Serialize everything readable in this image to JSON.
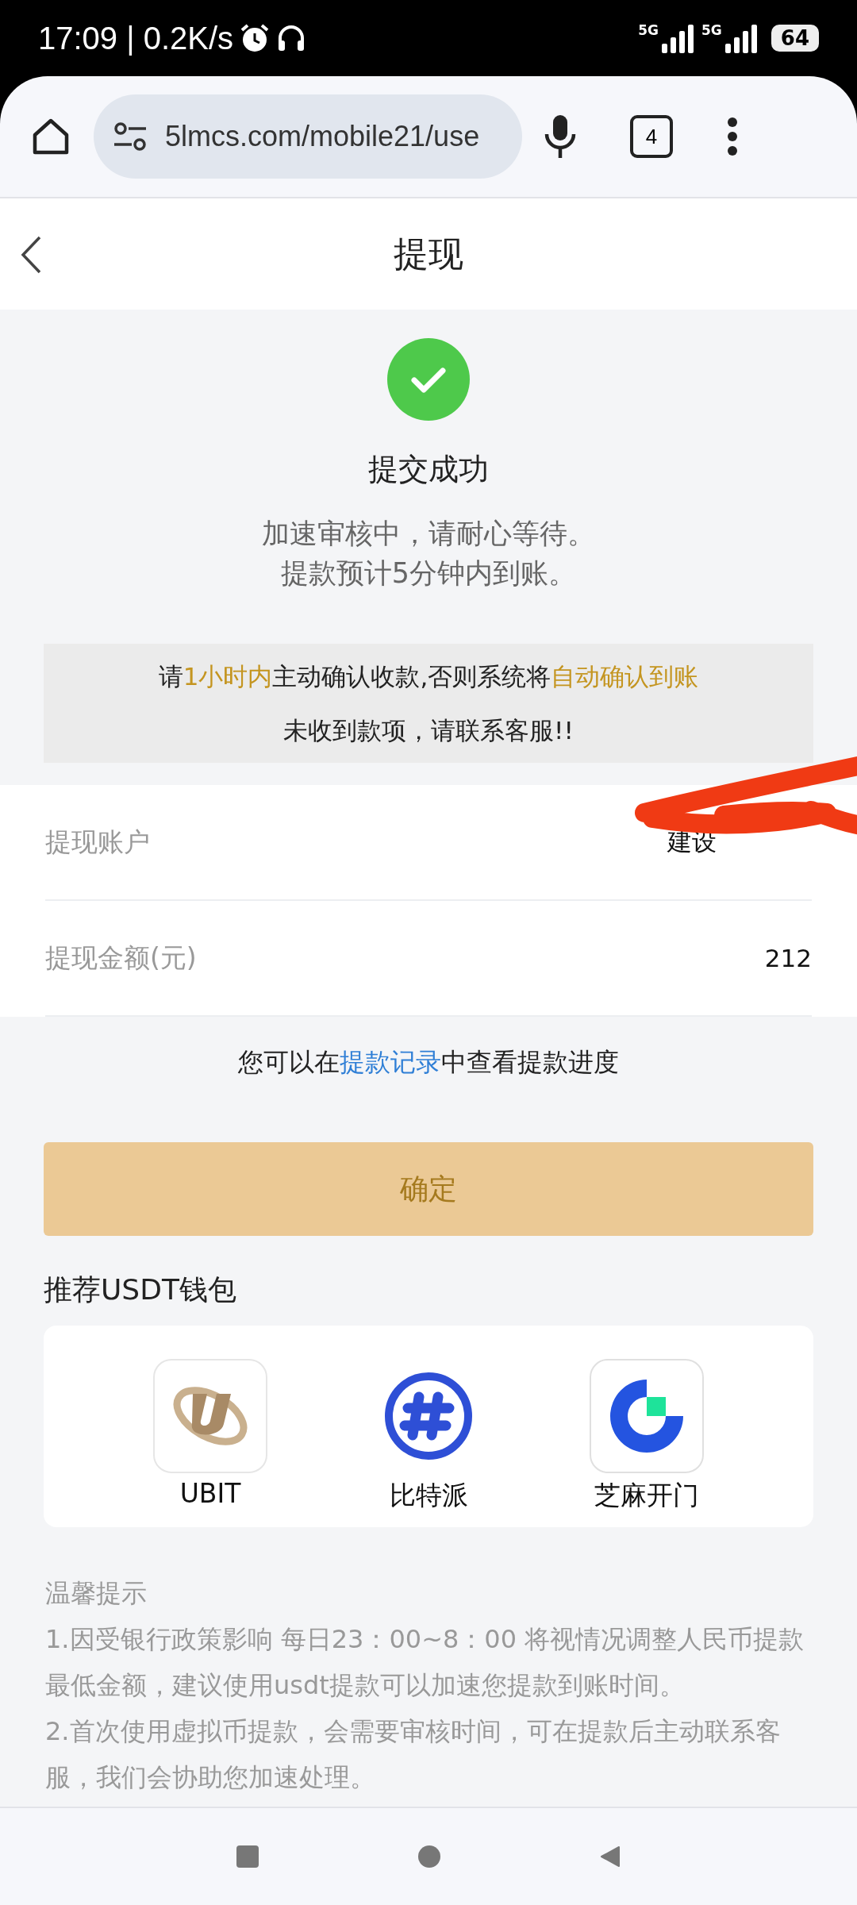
{
  "status_bar": {
    "time": "17:09 | 0.2K/s",
    "network_1": "5G",
    "network_2": "5G",
    "battery": "64"
  },
  "browser": {
    "url": "5lmcs.com/mobile21/use",
    "tab_count": "4"
  },
  "header": {
    "title": "提现"
  },
  "result": {
    "title": "提交成功",
    "lines": [
      "加速审核中，请耐心等待。",
      "提款预计5分钟内到账。"
    ]
  },
  "notice": {
    "segments": [
      {
        "text": "请",
        "highlight": false
      },
      {
        "text": "1小时内",
        "highlight": true
      },
      {
        "text": "主动确认收款,否则系统将",
        "highlight": false
      },
      {
        "text": "自动确认到账",
        "highlight": true
      }
    ],
    "line_2": "未收到款项，请联系客服!!"
  },
  "details": [
    {
      "label": "提现账户",
      "value": "建设",
      "redacted": true
    },
    {
      "label": "提现金额(元)",
      "value": "212",
      "redacted": false
    }
  ],
  "progress_hint": [
    {
      "text": "您可以在",
      "link": false
    },
    {
      "text": "提款记录",
      "link": true
    },
    {
      "text": "中查看提款进度",
      "link": false
    }
  ],
  "confirm_button": "确定",
  "wallets": {
    "title": "推荐USDT钱包",
    "items": [
      {
        "kind": "ubit",
        "name": "UBIT"
      },
      {
        "kind": "bitpie",
        "name": "比特派"
      },
      {
        "kind": "zhima",
        "name": "芝麻开门"
      }
    ]
  },
  "tips": {
    "title": "温馨提示",
    "lines": [
      "1.因受银行政策影响 每日23：00~8：00 将视情况调整人民币提款最低金额，建议使用usdt提款可以加速您提款到账时间。",
      "2.首次使用虚拟币提款，会需要审核时间，可在提款后主动联系客服，我们会协助您加速处理。"
    ]
  }
}
